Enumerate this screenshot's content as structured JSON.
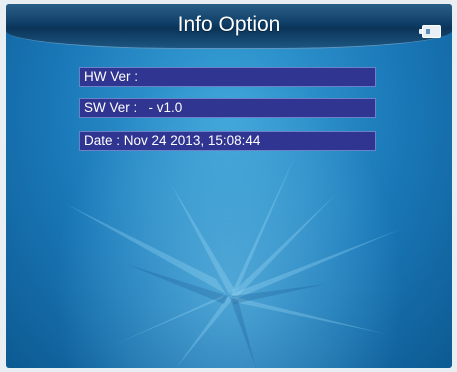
{
  "header": {
    "title": "Info Option",
    "status_icon": "card-icon"
  },
  "info": {
    "hw_ver": "HW Ver :",
    "sw_ver": "SW Ver :   - v1.0",
    "date": "Date : Nov 24 2013, 15:08:44"
  },
  "colors": {
    "background": "#1a78b8",
    "titlebar": "#0f3e66",
    "row_fill": "#2f3590",
    "text": "#ffffff"
  }
}
